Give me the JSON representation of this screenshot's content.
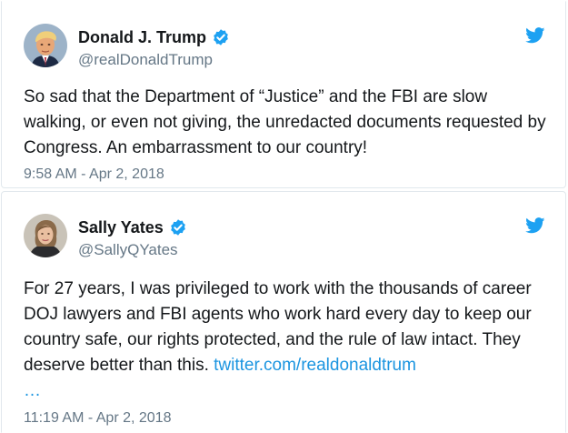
{
  "tweets": [
    {
      "name": "Donald J. Trump",
      "handle": "@realDonaldTrump",
      "verified": true,
      "icons": {
        "avatar": "avatar-photo",
        "verified": "verified-badge-icon",
        "brand": "twitter-bird-icon"
      },
      "text": "So sad that the Department of “Justice” and the FBI are slow walking, or even not giving, the unredacted documents requested by Congress. An embarrassment to our country!",
      "timestamp": "9:58 AM - Apr 2, 2018"
    },
    {
      "name": "Sally Yates",
      "handle": "@SallyQYates",
      "verified": true,
      "icons": {
        "avatar": "avatar-photo",
        "verified": "verified-badge-icon",
        "brand": "twitter-bird-icon"
      },
      "text": "For 27 years, I was privileged to work with the thousands of career DOJ lawyers and FBI agents who work hard every day to keep our country safe, our rights protected, and the rule of law intact. They deserve better than this. ",
      "link": "twitter.com/realdonaldtrum",
      "ellipsis": "…",
      "timestamp": "11:19 AM - Apr 2, 2018"
    }
  ],
  "colors": {
    "text": "#14171a",
    "secondary": "#657786",
    "link": "#1b95e0",
    "verified": "#1da1f2",
    "brand": "#1da1f2",
    "border": "#e1e8ed"
  }
}
